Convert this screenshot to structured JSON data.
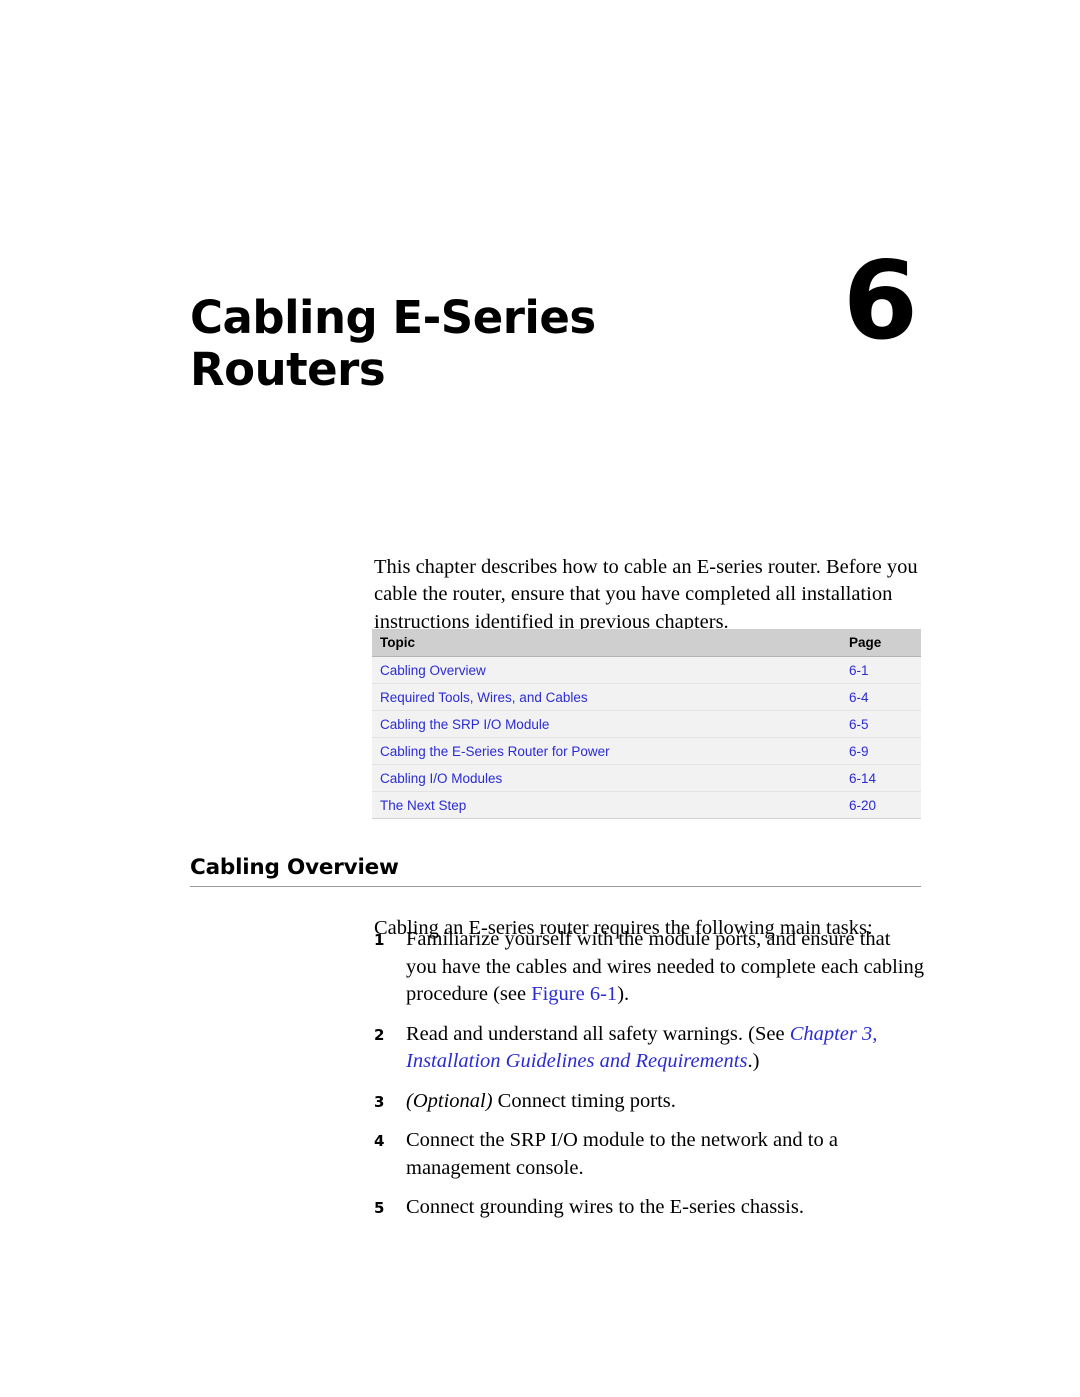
{
  "chapter": {
    "title": "Cabling E-Series Routers",
    "number": "6"
  },
  "intro": "This chapter describes how to cable an E-series router. Before you cable the router, ensure that you have completed all installation instructions identified in previous chapters.",
  "toc": {
    "headers": {
      "topic": "Topic",
      "page": "Page"
    },
    "rows": [
      {
        "topic": "Cabling Overview",
        "page": "6-1"
      },
      {
        "topic": "Required Tools, Wires, and Cables",
        "page": "6-4"
      },
      {
        "topic": "Cabling the SRP I/O Module",
        "page": "6-5"
      },
      {
        "topic": "Cabling the E-Series Router for Power",
        "page": "6-9"
      },
      {
        "topic": "Cabling I/O Modules",
        "page": "6-14"
      },
      {
        "topic": "The Next Step",
        "page": "6-20"
      }
    ]
  },
  "section": {
    "heading": "Cabling Overview",
    "lead": "Cabling an E-series router requires the following main tasks:",
    "steps": [
      {
        "number": "1",
        "text_before": "Familiarize yourself with the module ports, and ensure that you have the cables and wires needed to complete each cabling procedure (see ",
        "link": "Figure 6-1",
        "text_after": ")."
      },
      {
        "number": "2",
        "text_before": "Read and understand all safety warnings. (See ",
        "link": "Chapter 3, Installation Guidelines and Requirements",
        "text_after": ".)"
      },
      {
        "number": "3",
        "emphasis": "(Optional)",
        "text_after": " Connect timing ports."
      },
      {
        "number": "4",
        "text_after": "Connect the SRP I/O module to the network and to a management console."
      },
      {
        "number": "5",
        "text_after": "Connect grounding wires to the E-series chassis."
      }
    ]
  },
  "colors": {
    "link": "#2b2bd4",
    "table_header_bg": "#cfcfcf",
    "table_row_bg": "#f2f2f2",
    "rule": "#9a9a9a"
  }
}
